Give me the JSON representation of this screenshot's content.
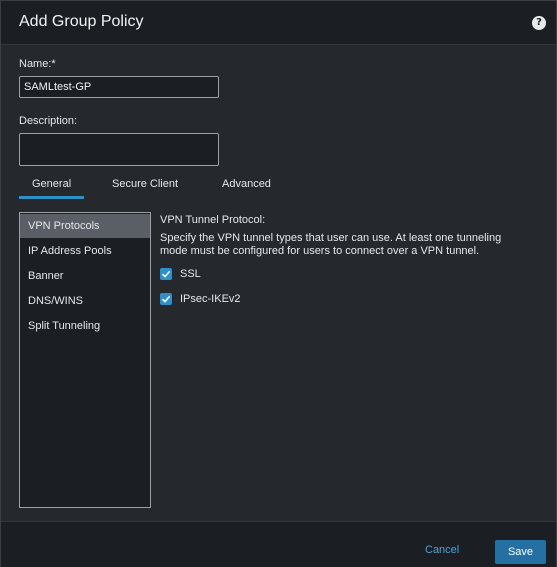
{
  "dialog": {
    "title": "Add Group Policy",
    "help_icon": "help-circle-icon",
    "help_glyph": "?"
  },
  "form": {
    "name_label": "Name:*",
    "name_value": "SAMLtest-GP",
    "description_label": "Description:",
    "description_value": ""
  },
  "tabs": [
    {
      "label": "General",
      "selected": true
    },
    {
      "label": "Secure Client",
      "selected": false
    },
    {
      "label": "Advanced",
      "selected": false
    }
  ],
  "sidebar": {
    "items": [
      {
        "label": "VPN Protocols",
        "selected": true
      },
      {
        "label": "IP Address Pools",
        "selected": false
      },
      {
        "label": "Banner",
        "selected": false
      },
      {
        "label": "DNS/WINS",
        "selected": false
      },
      {
        "label": "Split Tunneling",
        "selected": false
      }
    ]
  },
  "vpn": {
    "title": "VPN Tunnel Protocol:",
    "description": "Specify the VPN tunnel types that user can use. At least one tunneling mode must be configured for users to connect over a VPN tunnel.",
    "options": [
      {
        "label": "SSL",
        "checked": true
      },
      {
        "label": "IPsec-IKEv2",
        "checked": true
      }
    ]
  },
  "footer": {
    "cancel_label": "Cancel",
    "save_label": "Save"
  },
  "colors": {
    "accent": "#2e8fc9",
    "save_button": "#2470a3",
    "link": "#4aa3df",
    "selected_item": "#5a5f66"
  }
}
